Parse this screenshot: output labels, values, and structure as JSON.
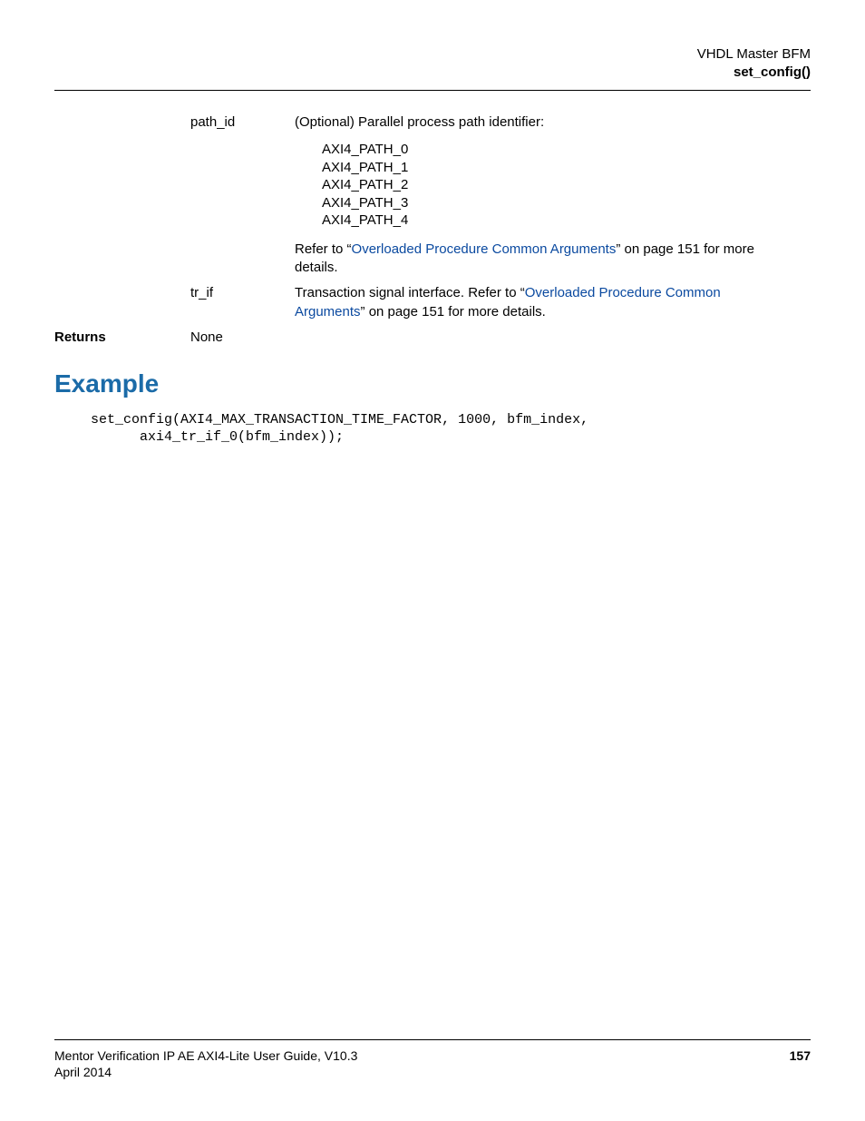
{
  "header": {
    "line1": "VHDL Master BFM",
    "line2": "set_config()"
  },
  "params": {
    "path_id": {
      "name": "path_id",
      "desc": "(Optional) Parallel process path identifier:",
      "enums": [
        "AXI4_PATH_0",
        "AXI4_PATH_1",
        "AXI4_PATH_2",
        "AXI4_PATH_3",
        "AXI4_PATH_4"
      ],
      "after_pre": "Refer to “",
      "after_link": "Overloaded Procedure Common Arguments",
      "after_post": "” on page 151 for more details."
    },
    "tr_if": {
      "name": "tr_if",
      "desc_pre": "Transaction signal interface. Refer to “",
      "desc_link": "Overloaded Procedure Common Arguments",
      "desc_post": "” on page 151 for more details."
    }
  },
  "returns": {
    "label": "Returns",
    "value": "None"
  },
  "example": {
    "heading": "Example",
    "code": "set_config(AXI4_MAX_TRANSACTION_TIME_FACTOR, 1000, bfm_index,\n      axi4_tr_if_0(bfm_index));"
  },
  "footer": {
    "title": "Mentor Verification IP AE AXI4-Lite User Guide, V10.3",
    "date": "April 2014",
    "page": "157"
  }
}
